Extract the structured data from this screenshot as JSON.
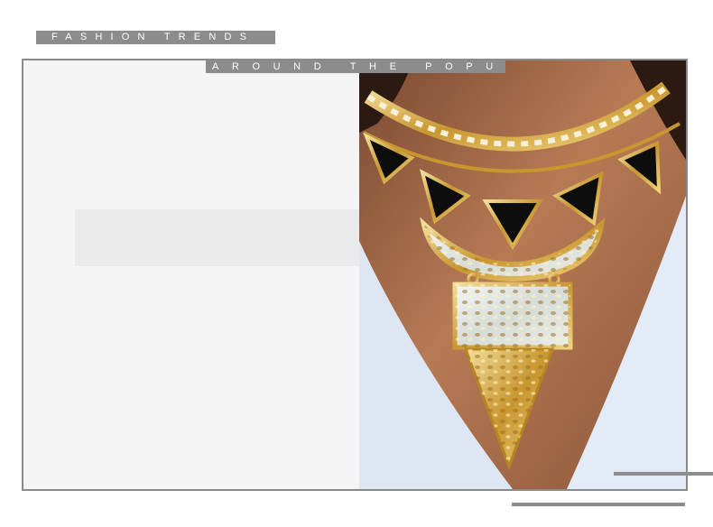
{
  "header": {
    "tag": "FASHION TRENDS",
    "subtag": "AROUND THE POPULAR"
  },
  "hero_image": {
    "icon": "necklace-photo",
    "description_visible": ""
  },
  "colors": {
    "tag_bg": "#8c8c8c",
    "frame_border": "#8a8a8a",
    "panel_bg": "#f4f4f4",
    "placeholder_bg": "#ebeaea",
    "skin": "#a06a48",
    "shirt": "#dde6f3",
    "gold": "#d4a94c",
    "onyx": "#0d0d0d"
  }
}
